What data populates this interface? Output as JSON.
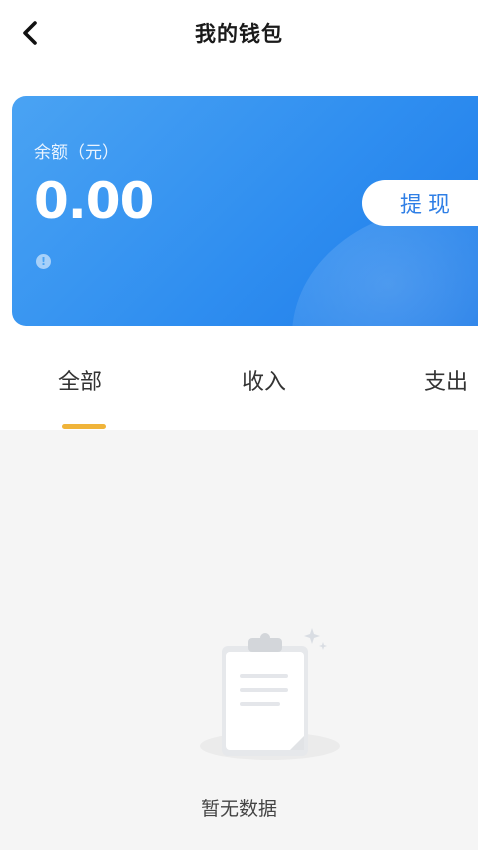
{
  "header": {
    "title": "我的钱包"
  },
  "wallet": {
    "balance_label": "余额（元）",
    "balance_value": "0.00",
    "withdraw_label": "提现"
  },
  "tabs": [
    {
      "label": "全部",
      "active": true
    },
    {
      "label": "收入",
      "active": false
    },
    {
      "label": "支出",
      "active": false
    }
  ],
  "empty_state": {
    "text": "暂无数据"
  },
  "colors": {
    "card_blue": "#2f8ef0",
    "tab_indicator": "#f0b43a",
    "content_bg": "#f5f5f5"
  }
}
